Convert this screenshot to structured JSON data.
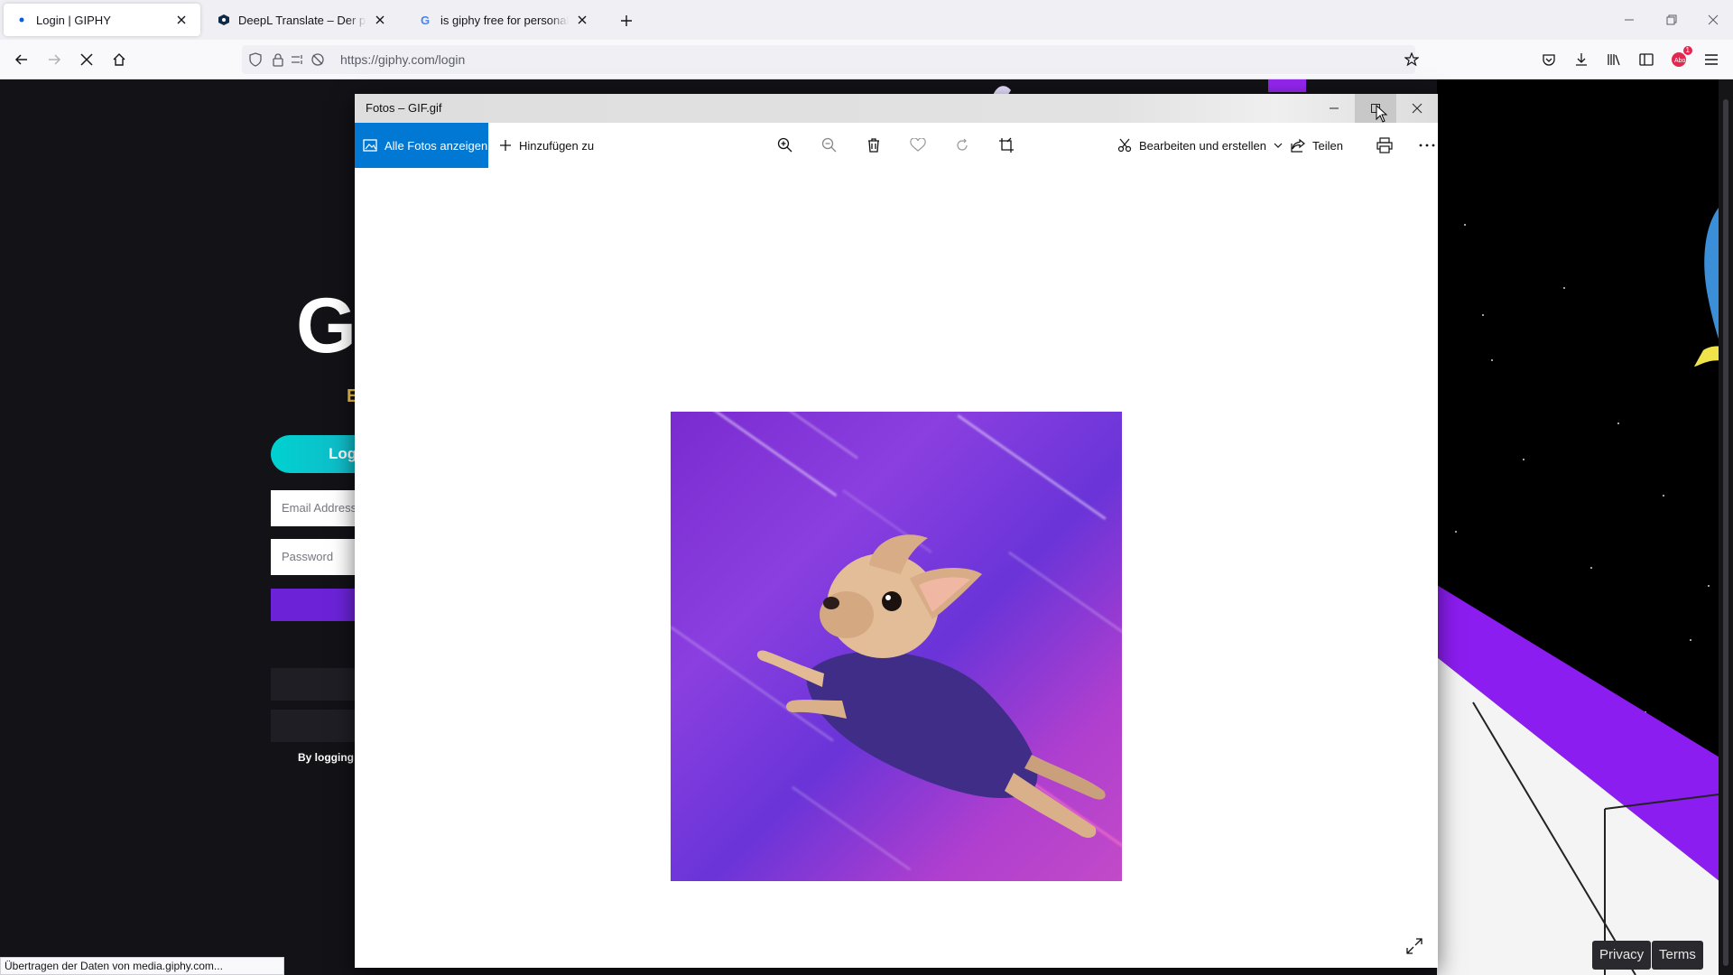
{
  "browser": {
    "tabs": [
      {
        "title": "Login | GIPHY",
        "active": true
      },
      {
        "title": "DeepL Translate – Der präziseste Übersetzer der Welt",
        "active": false
      },
      {
        "title": "is giphy free for personal use - Google Suche",
        "active": false
      }
    ],
    "url": "https://giphy.com/login",
    "extension_badge": "1",
    "status_text": "Übertragen der Daten von media.giphy.com..."
  },
  "giphy_page": {
    "logo_letter": "G",
    "subtitle_letter": "E",
    "login_tab_label": "Log",
    "email_placeholder": "Email Address",
    "password_placeholder": "Password",
    "terms_text": "By logging",
    "privacy_label": "Privacy",
    "terms_label": "Terms"
  },
  "photos_app": {
    "window_title": "Fotos – GIF.gif",
    "toolbar": {
      "all_photos_label": "Alle Fotos anzeigen",
      "add_to_label": "Hinzufügen zu",
      "edit_create_label": "Bearbeiten und erstellen",
      "share_label": "Teilen"
    },
    "icons": [
      "zoom-in-icon",
      "zoom-out-icon",
      "delete-icon",
      "heart-icon",
      "rotate-icon",
      "crop-icon",
      "print-icon",
      "more-icon",
      "fullscreen-icon"
    ],
    "accent_color": "#0078d4"
  }
}
